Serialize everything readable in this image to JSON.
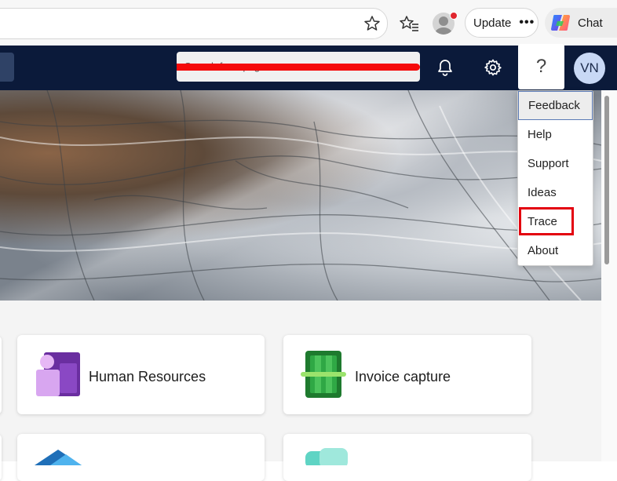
{
  "browser": {
    "update_label": "Update",
    "more_label": "•••",
    "chat_label": "Chat"
  },
  "header": {
    "search_text": "Search for a page",
    "user_initials": "VN",
    "help_label": "?"
  },
  "help_menu": {
    "items": [
      {
        "label": "Feedback"
      },
      {
        "label": "Help"
      },
      {
        "label": "Support"
      },
      {
        "label": "Ideas"
      },
      {
        "label": "Trace"
      },
      {
        "label": "About"
      }
    ]
  },
  "tiles": [
    {
      "title": "Human Resources",
      "icon": "human-resources-icon"
    },
    {
      "title": "Invoice capture",
      "icon": "invoice-capture-icon"
    }
  ],
  "colors": {
    "header_bg": "#0b1a3a",
    "highlight": "#e3000f",
    "avatar_bg": "#c8d8f5"
  }
}
